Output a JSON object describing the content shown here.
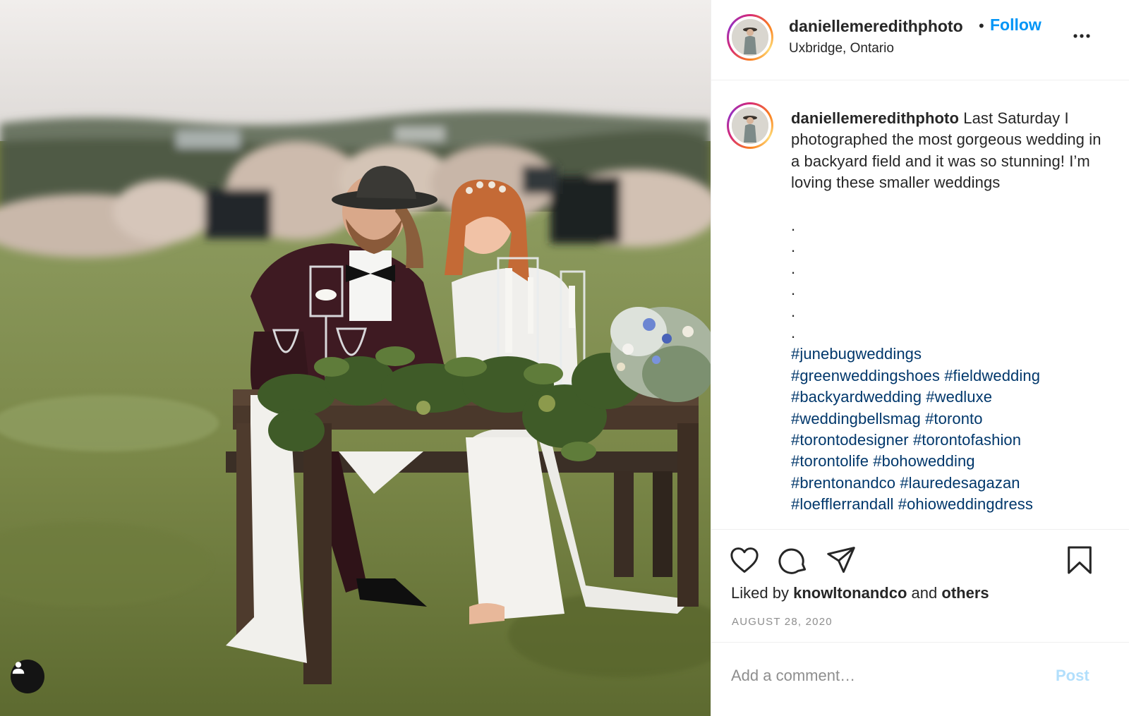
{
  "post": {
    "username": "daniellemeredithphoto",
    "separator": "•",
    "follow_label": "Follow",
    "location": "Uxbridge, Ontario",
    "more_icon": "more-horizontal-icon"
  },
  "caption": {
    "username": "daniellemeredithphoto",
    "text": "Last Saturday I photographed the most gorgeous wedding in a backyard field and it was so stunning! I’m loving these smaller weddings",
    "dots": [
      ".",
      ".",
      ".",
      ".",
      ".",
      "."
    ],
    "hashtag_lines": [
      [
        "#junebugweddings"
      ],
      [
        "#greenweddingshoes",
        "#fieldwedding"
      ],
      [
        "#backyardwedding",
        "#wedluxe"
      ],
      [
        "#weddingbellsmag",
        "#toronto"
      ],
      [
        "#torontodesigner",
        "#torontofashion"
      ],
      [
        "#torontolife",
        "#bohowedding"
      ],
      [
        "#brentonandco",
        "#lauredesagazan"
      ],
      [
        "#loefflerrandall",
        "#ohioweddingdress"
      ]
    ]
  },
  "actions": {
    "icons": [
      "heart-icon",
      "comment-icon",
      "share-icon",
      "bookmark-icon"
    ],
    "liked_prefix": "Liked by",
    "liked_user": "knowltonandco",
    "liked_and": "and",
    "liked_others": "others",
    "date": "AUGUST 28, 2020"
  },
  "comment": {
    "placeholder": "Add a comment…",
    "post_label": "Post"
  },
  "photo": {
    "tag_icon": "user-tag-icon"
  },
  "colors": {
    "link_blue": "#0095f6",
    "hashtag": "#00376b",
    "muted": "#8e8e8e",
    "post_disabled": "#b2dffc"
  }
}
